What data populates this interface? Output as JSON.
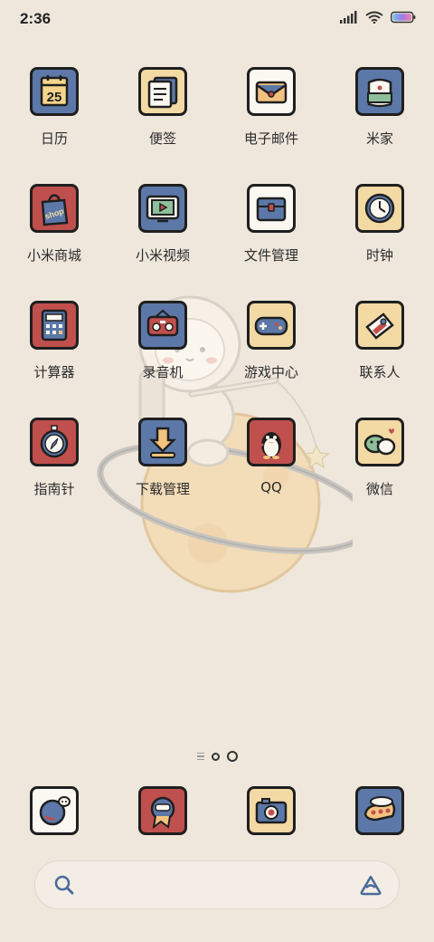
{
  "status_bar": {
    "time": "2:36",
    "icons": [
      "signal-icon",
      "wifi-icon",
      "battery-icon"
    ]
  },
  "apps": [
    {
      "label": "日历",
      "icon": "calendar-icon",
      "day": "25"
    },
    {
      "label": "便签",
      "icon": "notes-icon"
    },
    {
      "label": "电子邮件",
      "icon": "email-icon"
    },
    {
      "label": "米家",
      "icon": "mijia-icon"
    },
    {
      "label": "小米商城",
      "icon": "mi-store-icon",
      "bag_text": "shop"
    },
    {
      "label": "小米视频",
      "icon": "video-icon"
    },
    {
      "label": "文件管理",
      "icon": "file-manager-icon"
    },
    {
      "label": "时钟",
      "icon": "clock-icon"
    },
    {
      "label": "计算器",
      "icon": "calculator-icon"
    },
    {
      "label": "录音机",
      "icon": "recorder-icon"
    },
    {
      "label": "游戏中心",
      "icon": "game-center-icon"
    },
    {
      "label": "联系人",
      "icon": "contacts-icon"
    },
    {
      "label": "指南针",
      "icon": "compass-icon"
    },
    {
      "label": "下载管理",
      "icon": "downloads-icon"
    },
    {
      "label": "QQ",
      "icon": "qq-icon"
    },
    {
      "label": "微信",
      "icon": "wechat-icon"
    }
  ],
  "dock": [
    {
      "icon": "phone-icon"
    },
    {
      "icon": "messages-icon"
    },
    {
      "icon": "camera-icon"
    },
    {
      "icon": "browser-icon"
    }
  ],
  "page_indicator": {
    "pages": 2,
    "current": 2
  },
  "search_bar": {
    "icon": "search-icon",
    "assistant_icon": "assistant-icon"
  },
  "colors": {
    "background": "#efe7dc",
    "tile_blue": "#5c78a8",
    "tile_red": "#c0504d",
    "tile_cream": "#f3d9a4",
    "tile_white": "#fbf8f1"
  }
}
